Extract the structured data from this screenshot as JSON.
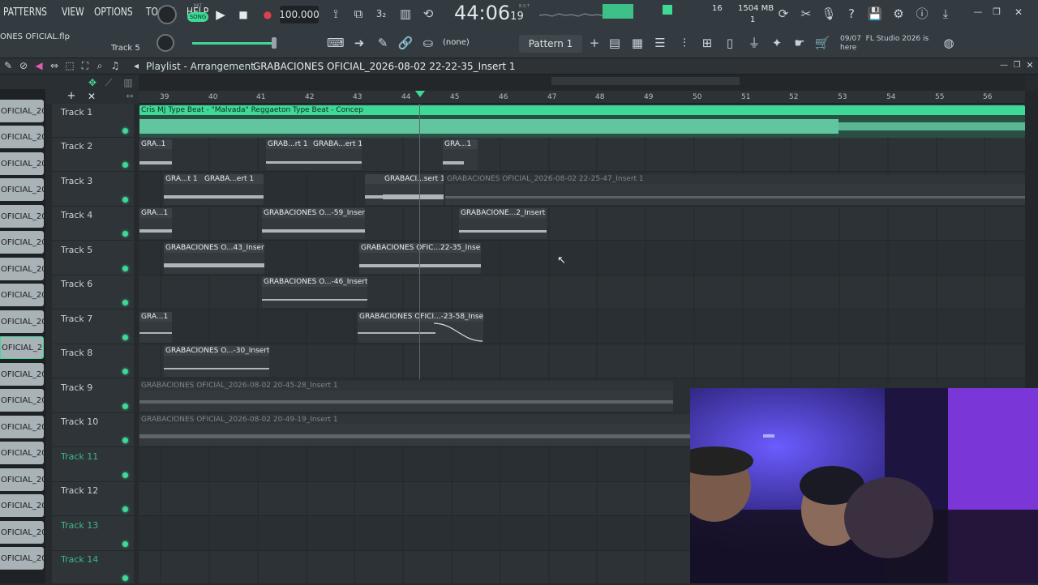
{
  "menu": [
    "PATTERNS",
    "VIEW",
    "OPTIONS",
    "TOOLS",
    "HELP"
  ],
  "transport": {
    "pat_label": "PAT",
    "song_label": "SONG",
    "tempo": "100.000",
    "time": "44:06",
    "time_sub": "19",
    "bst": "B:S:T"
  },
  "monitor": {
    "cpu": "16",
    "mem": "1504 MB",
    "voices": "1"
  },
  "project": {
    "file": "ONES OFICIAL.flp",
    "hint": "Track 5"
  },
  "toolbar": {
    "none_label": "(none)",
    "pattern_label": "Pattern 1"
  },
  "news": {
    "date": "09/07",
    "text": "FL Studio 2026 is here"
  },
  "playlist": {
    "title": "Playlist - Arrangement",
    "breadcrumb": "GRABACIONES OFICIAL_2026-08-02 22-22-35_Insert 1"
  },
  "ruler": [
    "39",
    "40",
    "41",
    "42",
    "43",
    "44",
    "45",
    "46",
    "47",
    "48",
    "49",
    "50",
    "51",
    "52",
    "53",
    "54",
    "55",
    "56"
  ],
  "browser_items": [
    "OFICIAL_20..",
    "OFICIAL_20..",
    "OFICIAL_20..",
    "OFICIAL_20..",
    "OFICIAL_20..",
    "OFICIAL_20..",
    "OFICIAL_20..",
    "OFICIAL_20..",
    "OFICIAL_20..",
    "OFICIAL_20..",
    "OFICIAL_20..",
    "OFICIAL_20..",
    "OFICIAL_20..",
    "OFICIAL_20..",
    "OFICIAL_20..",
    "OFICIAL_20..",
    "OFICIAL_20..",
    "OFICIAL_20.."
  ],
  "tracks": [
    {
      "name": "Track 1",
      "empty": false
    },
    {
      "name": "Track 2",
      "empty": false
    },
    {
      "name": "Track 3",
      "empty": false
    },
    {
      "name": "Track 4",
      "empty": false
    },
    {
      "name": "Track 5",
      "empty": false
    },
    {
      "name": "Track 6",
      "empty": false
    },
    {
      "name": "Track 7",
      "empty": false
    },
    {
      "name": "Track 8",
      "empty": false
    },
    {
      "name": "Track 9",
      "empty": false
    },
    {
      "name": "Track 10",
      "empty": false
    },
    {
      "name": "Track 11",
      "empty": true
    },
    {
      "name": "Track 12",
      "empty": false
    },
    {
      "name": "Track 13",
      "empty": true
    },
    {
      "name": "Track 14",
      "empty": true
    }
  ],
  "clips": {
    "t1": "Cris MJ Type Beat - \"Malvada\" Reggaeton Type Beat - Concep",
    "t2a": "GRA..1",
    "t2b": "GRAB...rt 1",
    "t2c": "GRABA...ert 1",
    "t2d": "GRA...1",
    "t3a": "GRA...t 1",
    "t3b": "GRABA...ert 1",
    "t3c": "",
    "t3d": "GRABACI...sert 1",
    "t3e": "GRABACIONES OFICIAL_2026-08-02 22-25-47_Insert 1",
    "t4a": "GRA...1",
    "t4b": "GRABACIONES O...-59_Insert 1",
    "t4c": "GRABACIONE...2_Insert 1",
    "t5a": "GRABACIONES O...43_Insert 1",
    "t5b": "GRABACIONES OFIC...22-35_Insert 1",
    "t6a": "GRABACIONES O...-46_Insert 1",
    "t7a": "GRA...1",
    "t7b": "GRABACIONES OFICI...-23-58_Insert 1",
    "t8a": "GRABACIONES O...-30_Insert 1",
    "t9": "GRABACIONES OFICIAL_2026-08-02 20-45-28_Insert 1",
    "t10": "GRABACIONES OFICIAL_2026-08-02 20-49-19_Insert 1"
  },
  "colors": {
    "accent": "#3fd996",
    "bg": "#2a2f33"
  }
}
